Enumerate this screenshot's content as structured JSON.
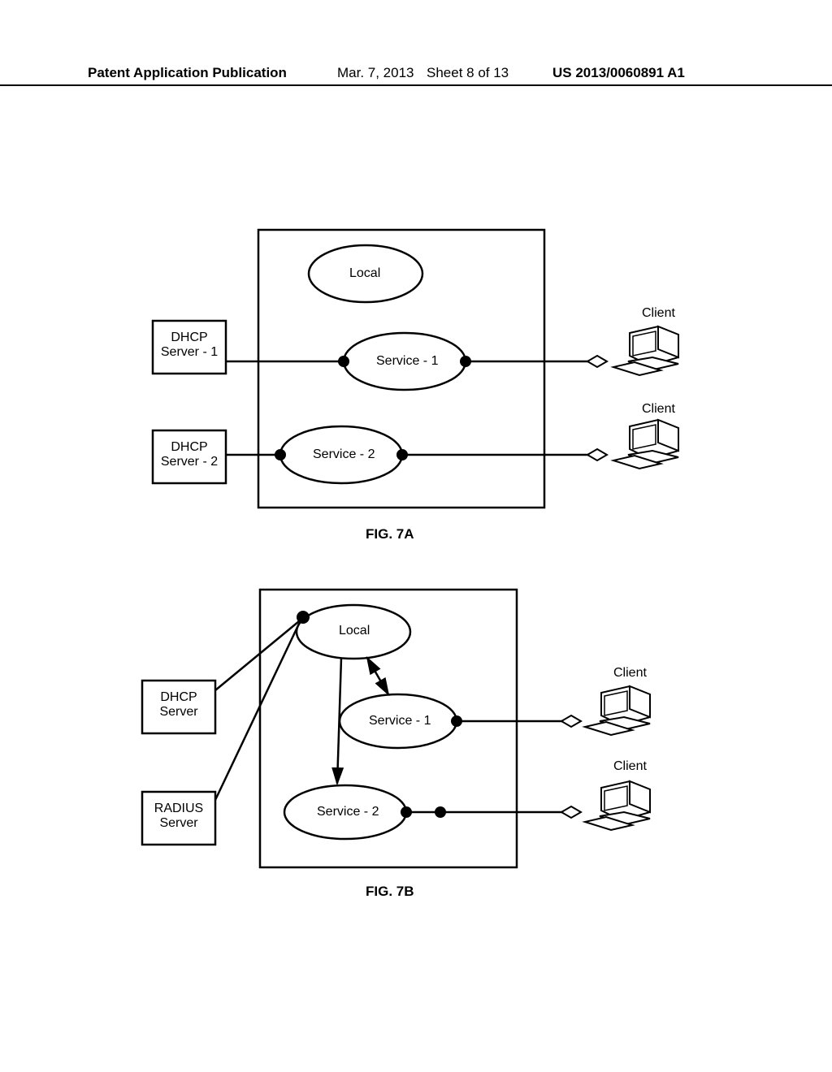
{
  "header": {
    "title": "Patent Application Publication",
    "date": "Mar. 7, 2013",
    "sheet": "Sheet 8 of 13",
    "pubno": "US 2013/0060891 A1"
  },
  "figA": {
    "caption": "FIG. 7A",
    "dhcp1_l1": "DHCP",
    "dhcp1_l2": "Server - 1",
    "dhcp2_l1": "DHCP",
    "dhcp2_l2": "Server - 2",
    "local": "Local",
    "service1": "Service - 1",
    "service2": "Service - 2",
    "client1": "Client",
    "client2": "Client"
  },
  "figB": {
    "caption": "FIG. 7B",
    "dhcp_l1": "DHCP",
    "dhcp_l2": "Server",
    "radius_l1": "RADIUS",
    "radius_l2": "Server",
    "local": "Local",
    "service1": "Service - 1",
    "service2": "Service - 2",
    "client1": "Client",
    "client2": "Client"
  }
}
